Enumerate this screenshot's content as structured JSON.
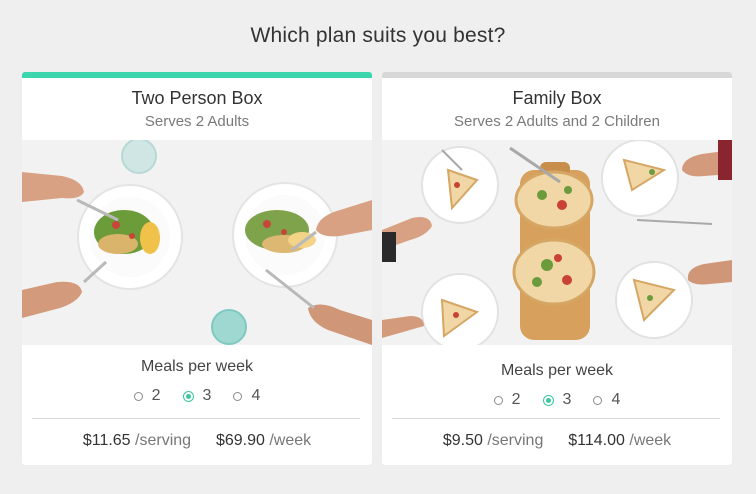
{
  "page": {
    "title": "Which plan suits you best?"
  },
  "colors": {
    "selected_accent": "#3cc7a1",
    "unselected_bar": "#d8d8d8"
  },
  "plans": [
    {
      "title": "Two Person Box",
      "subtitle": "Serves 2 Adults",
      "selected": true,
      "meals_label": "Meals per week",
      "options": [
        "2",
        "3",
        "4"
      ],
      "selected_option": "3",
      "price_serving": "$11.65",
      "serving_unit": "/serving",
      "price_week": "$69.90",
      "week_unit": "/week"
    },
    {
      "title": "Family Box",
      "subtitle": "Serves 2  Adults and 2 Children",
      "selected": false,
      "meals_label": "Meals per week",
      "options": [
        "2",
        "3",
        "4"
      ],
      "selected_option": "3",
      "price_serving": "$9.50",
      "serving_unit": "/serving",
      "price_week": "$114.00",
      "week_unit": "/week"
    }
  ]
}
